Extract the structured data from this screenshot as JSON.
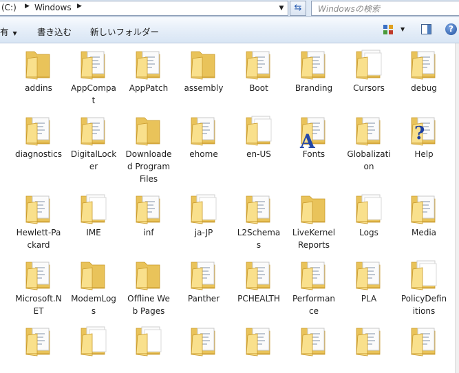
{
  "address_bar": {
    "segments": [
      "(C:)",
      "Windows"
    ],
    "refresh_icon": "refresh-icon",
    "search_placeholder": "Windowsの検索"
  },
  "toolbar": {
    "share_label": "有",
    "burn_label": "書き込む",
    "new_folder_label": "新しいフォルダー",
    "view_icon": "view-options-icon",
    "pane_icon": "preview-pane-icon",
    "help_label": "?"
  },
  "folders": [
    {
      "name": "addins",
      "style": "plain"
    },
    {
      "name": "AppCompat",
      "style": "doc"
    },
    {
      "name": "AppPatch",
      "style": "doc"
    },
    {
      "name": "assembly",
      "style": "plain"
    },
    {
      "name": "Boot",
      "style": "doc"
    },
    {
      "name": "Branding",
      "style": "doc"
    },
    {
      "name": "Cursors",
      "style": "paper"
    },
    {
      "name": "debug",
      "style": "doc"
    },
    {
      "name": "diagnostics",
      "style": "doc"
    },
    {
      "name": "DigitalLocker",
      "style": "doc"
    },
    {
      "name": "Downloaded Program Files",
      "style": "plain"
    },
    {
      "name": "ehome",
      "style": "doc"
    },
    {
      "name": "en-US",
      "style": "paper"
    },
    {
      "name": "Fonts",
      "style": "fonts",
      "badge": "A"
    },
    {
      "name": "Globalization",
      "style": "doc"
    },
    {
      "name": "Help",
      "style": "help",
      "badge": "?"
    },
    {
      "name": "Hewlett-Packard",
      "style": "doc"
    },
    {
      "name": "IME",
      "style": "paper"
    },
    {
      "name": "inf",
      "style": "doc"
    },
    {
      "name": "ja-JP",
      "style": "paper"
    },
    {
      "name": "L2Schemas",
      "style": "doc"
    },
    {
      "name": "LiveKernelReports",
      "style": "plain"
    },
    {
      "name": "Logs",
      "style": "paper"
    },
    {
      "name": "Media",
      "style": "doc"
    },
    {
      "name": "Microsoft.NET",
      "style": "doc"
    },
    {
      "name": "ModemLogs",
      "style": "plain"
    },
    {
      "name": "Offline Web Pages",
      "style": "plain"
    },
    {
      "name": "Panther",
      "style": "doc"
    },
    {
      "name": "PCHEALTH",
      "style": "doc"
    },
    {
      "name": "Performance",
      "style": "doc"
    },
    {
      "name": "PLA",
      "style": "doc"
    },
    {
      "name": "PolicyDefinitions",
      "style": "paper"
    },
    {
      "name": "",
      "style": "doc"
    },
    {
      "name": "",
      "style": "paper"
    },
    {
      "name": "",
      "style": "paper"
    },
    {
      "name": "",
      "style": "doc"
    },
    {
      "name": "",
      "style": "doc"
    },
    {
      "name": "",
      "style": "doc"
    },
    {
      "name": "",
      "style": "doc"
    },
    {
      "name": "",
      "style": "doc"
    }
  ],
  "colors": {
    "folder_back": "#e9c35a",
    "folder_front": "#f9e08c",
    "folder_edge": "#c99a2c",
    "paper": "#fbfbfb"
  }
}
